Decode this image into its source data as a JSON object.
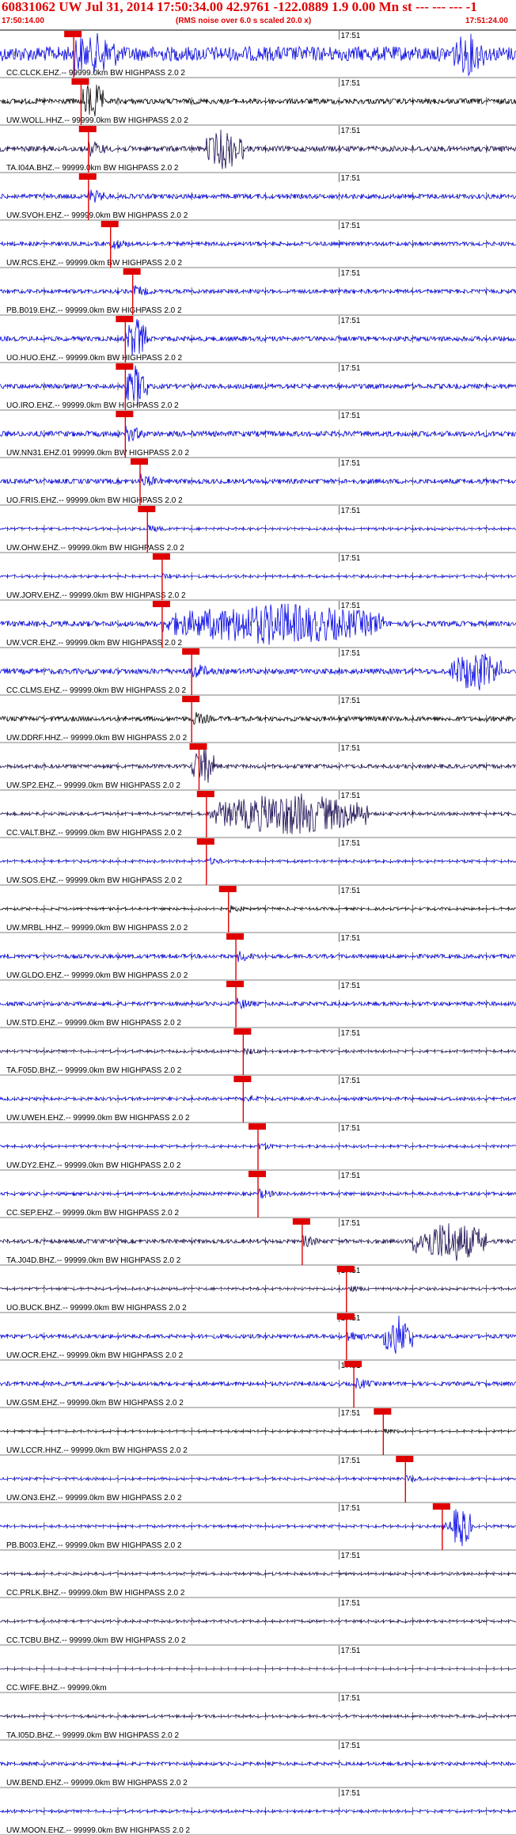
{
  "header": {
    "title": "60831062 UW Jul 31, 2014 17:50:34.00   42.9761 -122.0889  1.9 0.00 Mn st --- --- --- -1",
    "start_time": "17:50:14.00",
    "note": "(RMS noise over 6.0 s scaled 20.0 x)",
    "end_time": "17:51:24.00"
  },
  "colors": {
    "trace_blue": "#0000e6",
    "trace_dark": "#1a0a50",
    "trace_black": "#000000",
    "pick_red": "#e00000",
    "header_red": "#e00000"
  },
  "chart_data": {
    "type": "line",
    "title": "60831062 UW Jul 31, 2014 17:50:34.00   42.9761 -122.0889  1.9 0.00 Mn st --- --- --- -1",
    "xlim": [
      "17:50:14.00",
      "17:51:24.00"
    ],
    "x_tick_label": "17:51",
    "grid": false,
    "series": [
      {
        "name": "CC.CLCK.EHZ.-- 99999.0km BW  HIGHPASS  2.0  2",
        "color": "#0000e6",
        "amp": 0.95,
        "pick": "17:50:24",
        "bursts": [
          [
            "17:50:25",
            "17:50:30"
          ],
          [
            "17:51:15",
            "17:51:20"
          ]
        ]
      },
      {
        "name": "UW.WOLL.HHZ.-- 99999.0km BW  HIGHPASS  2.0  2",
        "color": "#000000",
        "amp": 0.35,
        "pick": "17:50:25",
        "bursts": [
          [
            "17:50:25",
            "17:50:28"
          ]
        ]
      },
      {
        "name": "TA.I04A.BHZ.-- 99999.0km BW  HIGHPASS  2.0  2",
        "color": "#1a0a50",
        "amp": 0.35,
        "pick": "17:50:26",
        "bursts": [
          [
            "17:50:42",
            "17:50:47"
          ]
        ]
      },
      {
        "name": "UW.SVOH.EHZ.-- 99999.0km BW  HIGHPASS  2.0  2",
        "color": "#0000e6",
        "amp": 0.3,
        "pick": "17:50:26",
        "bursts": []
      },
      {
        "name": "UW.RCS.EHZ.-- 99999.0km BW  HIGHPASS  2.0  2",
        "color": "#0000e6",
        "amp": 0.25,
        "pick": "17:50:29",
        "bursts": []
      },
      {
        "name": "PB.B019.EHZ.-- 99999.0km BW  HIGHPASS  2.0  2",
        "color": "#0000e6",
        "amp": 0.25,
        "pick": "17:50:32",
        "bursts": []
      },
      {
        "name": "UO.HUO.EHZ.-- 99999.0km BW  HIGHPASS  2.0  2",
        "color": "#0000e6",
        "amp": 0.3,
        "pick": "17:50:31",
        "bursts": [
          [
            "17:50:31",
            "17:50:34"
          ]
        ]
      },
      {
        "name": "UO.IRO.EHZ.-- 99999.0km BW  HIGHPASS  2.0  2",
        "color": "#0000e6",
        "amp": 0.3,
        "pick": "17:50:31",
        "bursts": [
          [
            "17:50:31",
            "17:50:34"
          ]
        ]
      },
      {
        "name": "UW.NN31.EHZ.01 99999.0km BW  HIGHPASS  2.0  2",
        "color": "#0000e6",
        "amp": 0.35,
        "pick": "17:50:31",
        "bursts": []
      },
      {
        "name": "UO.FRIS.EHZ.-- 99999.0km BW  HIGHPASS  2.0  2",
        "color": "#0000e6",
        "amp": 0.3,
        "pick": "17:50:33",
        "bursts": []
      },
      {
        "name": "UW.OHW.EHZ.-- 99999.0km BW  HIGHPASS  2.0  2",
        "color": "#0000e6",
        "amp": 0.15,
        "pick": "17:50:34",
        "bursts": []
      },
      {
        "name": "UW.JORV.EHZ.-- 99999.0km BW  HIGHPASS  2.0  2",
        "color": "#0000e6",
        "amp": 0.15,
        "pick": "17:50:36",
        "bursts": []
      },
      {
        "name": "UW.VCR.EHZ.-- 99999.0km BW  HIGHPASS  2.0  2",
        "color": "#0000e6",
        "amp": 0.35,
        "pick": "17:50:36",
        "bursts": [
          [
            "17:50:37",
            "17:51:06"
          ]
        ]
      },
      {
        "name": "CC.CLMS.EHZ.-- 99999.0km BW  HIGHPASS  2.0  2",
        "color": "#0000e6",
        "amp": 0.35,
        "pick": "17:50:40",
        "bursts": [
          [
            "17:51:15",
            "17:51:22"
          ]
        ]
      },
      {
        "name": "UW.DDRF.HHZ.-- 99999.0km BW  HIGHPASS  2.0  2",
        "color": "#000000",
        "amp": 0.3,
        "pick": "17:50:40",
        "bursts": []
      },
      {
        "name": "UW.SP2.EHZ.-- 99999.0km BW  HIGHPASS  2.0  2",
        "color": "#1a0a50",
        "amp": 0.25,
        "pick": "17:50:41",
        "bursts": [
          [
            "17:50:40",
            "17:50:43"
          ]
        ]
      },
      {
        "name": "CC.VALT.BHZ.-- 99999.0km BW  HIGHPASS  2.0  2",
        "color": "#1a0a50",
        "amp": 0.2,
        "pick": "17:50:42",
        "bursts": [
          [
            "17:50:43",
            "17:51:04"
          ]
        ]
      },
      {
        "name": "UW.SOS.EHZ.-- 99999.0km BW  HIGHPASS  2.0  2",
        "color": "#0000e6",
        "amp": 0.15,
        "pick": "17:50:42",
        "bursts": []
      },
      {
        "name": "UW.MRBL.HHZ.-- 99999.0km BW  HIGHPASS  2.0  2",
        "color": "#000000",
        "amp": 0.15,
        "pick": "17:50:45",
        "bursts": []
      },
      {
        "name": "UW.GLDO.EHZ.-- 99999.0km BW  HIGHPASS  2.0  2",
        "color": "#0000e6",
        "amp": 0.25,
        "pick": "17:50:46",
        "bursts": []
      },
      {
        "name": "UW.STD.EHZ.-- 99999.0km BW  HIGHPASS  2.0  2",
        "color": "#0000e6",
        "amp": 0.25,
        "pick": "17:50:46",
        "bursts": []
      },
      {
        "name": "TA.F05D.BHZ.-- 99999.0km BW  HIGHPASS  2.0  2",
        "color": "#1a0a50",
        "amp": 0.15,
        "pick": "17:50:47",
        "bursts": []
      },
      {
        "name": "UW.UWEH.EHZ.-- 99999.0km BW  HIGHPASS  2.0  2",
        "color": "#0000e6",
        "amp": 0.2,
        "pick": "17:50:47",
        "bursts": []
      },
      {
        "name": "UW.DY2.EHZ.-- 99999.0km BW  HIGHPASS  2.0  2",
        "color": "#0000e6",
        "amp": 0.15,
        "pick": "17:50:49",
        "bursts": []
      },
      {
        "name": "CC.SEP.EHZ.-- 99999.0km BW  HIGHPASS  2.0  2",
        "color": "#0000e6",
        "amp": 0.2,
        "pick": "17:50:49",
        "bursts": []
      },
      {
        "name": "TA.J04D.BHZ.-- 99999.0km BW  HIGHPASS  2.0  2",
        "color": "#1a0a50",
        "amp": 0.25,
        "pick": "17:50:55",
        "bursts": [
          [
            "17:51:10",
            "17:51:20"
          ]
        ]
      },
      {
        "name": "UO.BUCK.BHZ.-- 99999.0km BW  HIGHPASS  2.0  2",
        "color": "#1a0a50",
        "amp": 0.15,
        "pick": "17:51:01",
        "bursts": []
      },
      {
        "name": "UW.OCR.EHZ.-- 99999.0km BW  HIGHPASS  2.0  2",
        "color": "#0000e6",
        "amp": 0.25,
        "pick": "17:51:01",
        "bursts": [
          [
            "17:51:06",
            "17:51:10"
          ]
        ]
      },
      {
        "name": "UW.GSM.EHZ.-- 99999.0km BW  HIGHPASS  2.0  2",
        "color": "#0000e6",
        "amp": 0.25,
        "pick": "17:51:02",
        "bursts": []
      },
      {
        "name": "UW.LCCR.HHZ.-- 99999.0km BW  HIGHPASS  2.0  2",
        "color": "#000000",
        "amp": 0.1,
        "pick": "17:51:06",
        "bursts": []
      },
      {
        "name": "UW.ON3.EHZ.-- 99999.0km BW  HIGHPASS  2.0  2",
        "color": "#0000e6",
        "amp": 0.15,
        "pick": "17:51:09",
        "bursts": []
      },
      {
        "name": "PB.B003.EHZ.-- 99999.0km BW  HIGHPASS  2.0  2",
        "color": "#0000e6",
        "amp": 0.15,
        "pick": "17:51:14",
        "bursts": [
          [
            "17:51:15",
            "17:51:18"
          ]
        ]
      },
      {
        "name": "CC.PRLK.BHZ.-- 99999.0km BW  HIGHPASS  2.0  2",
        "color": "#1a0a50",
        "amp": 0.15,
        "pick": null,
        "bursts": []
      },
      {
        "name": "CC.TCBU.BHZ.-- 99999.0km BW  HIGHPASS  2.0  2",
        "color": "#1a0a50",
        "amp": 0.15,
        "pick": null,
        "bursts": []
      },
      {
        "name": "CC.WIFE.BHZ.-- 99999.0km",
        "color": "#1a0a50",
        "amp": 0.05,
        "pick": null,
        "bursts": []
      },
      {
        "name": "TA.I05D.BHZ.-- 99999.0km BW  HIGHPASS  2.0  2",
        "color": "#1a0a50",
        "amp": 0.15,
        "pick": null,
        "bursts": []
      },
      {
        "name": "UW.BEND.EHZ.-- 99999.0km BW  HIGHPASS  2.0  2",
        "color": "#0000e6",
        "amp": 0.2,
        "pick": null,
        "bursts": []
      },
      {
        "name": "UW.MOON.EHZ.-- 99999.0km BW  HIGHPASS  2.0  2",
        "color": "#0000e6",
        "amp": 0.15,
        "pick": null,
        "bursts": []
      }
    ]
  }
}
